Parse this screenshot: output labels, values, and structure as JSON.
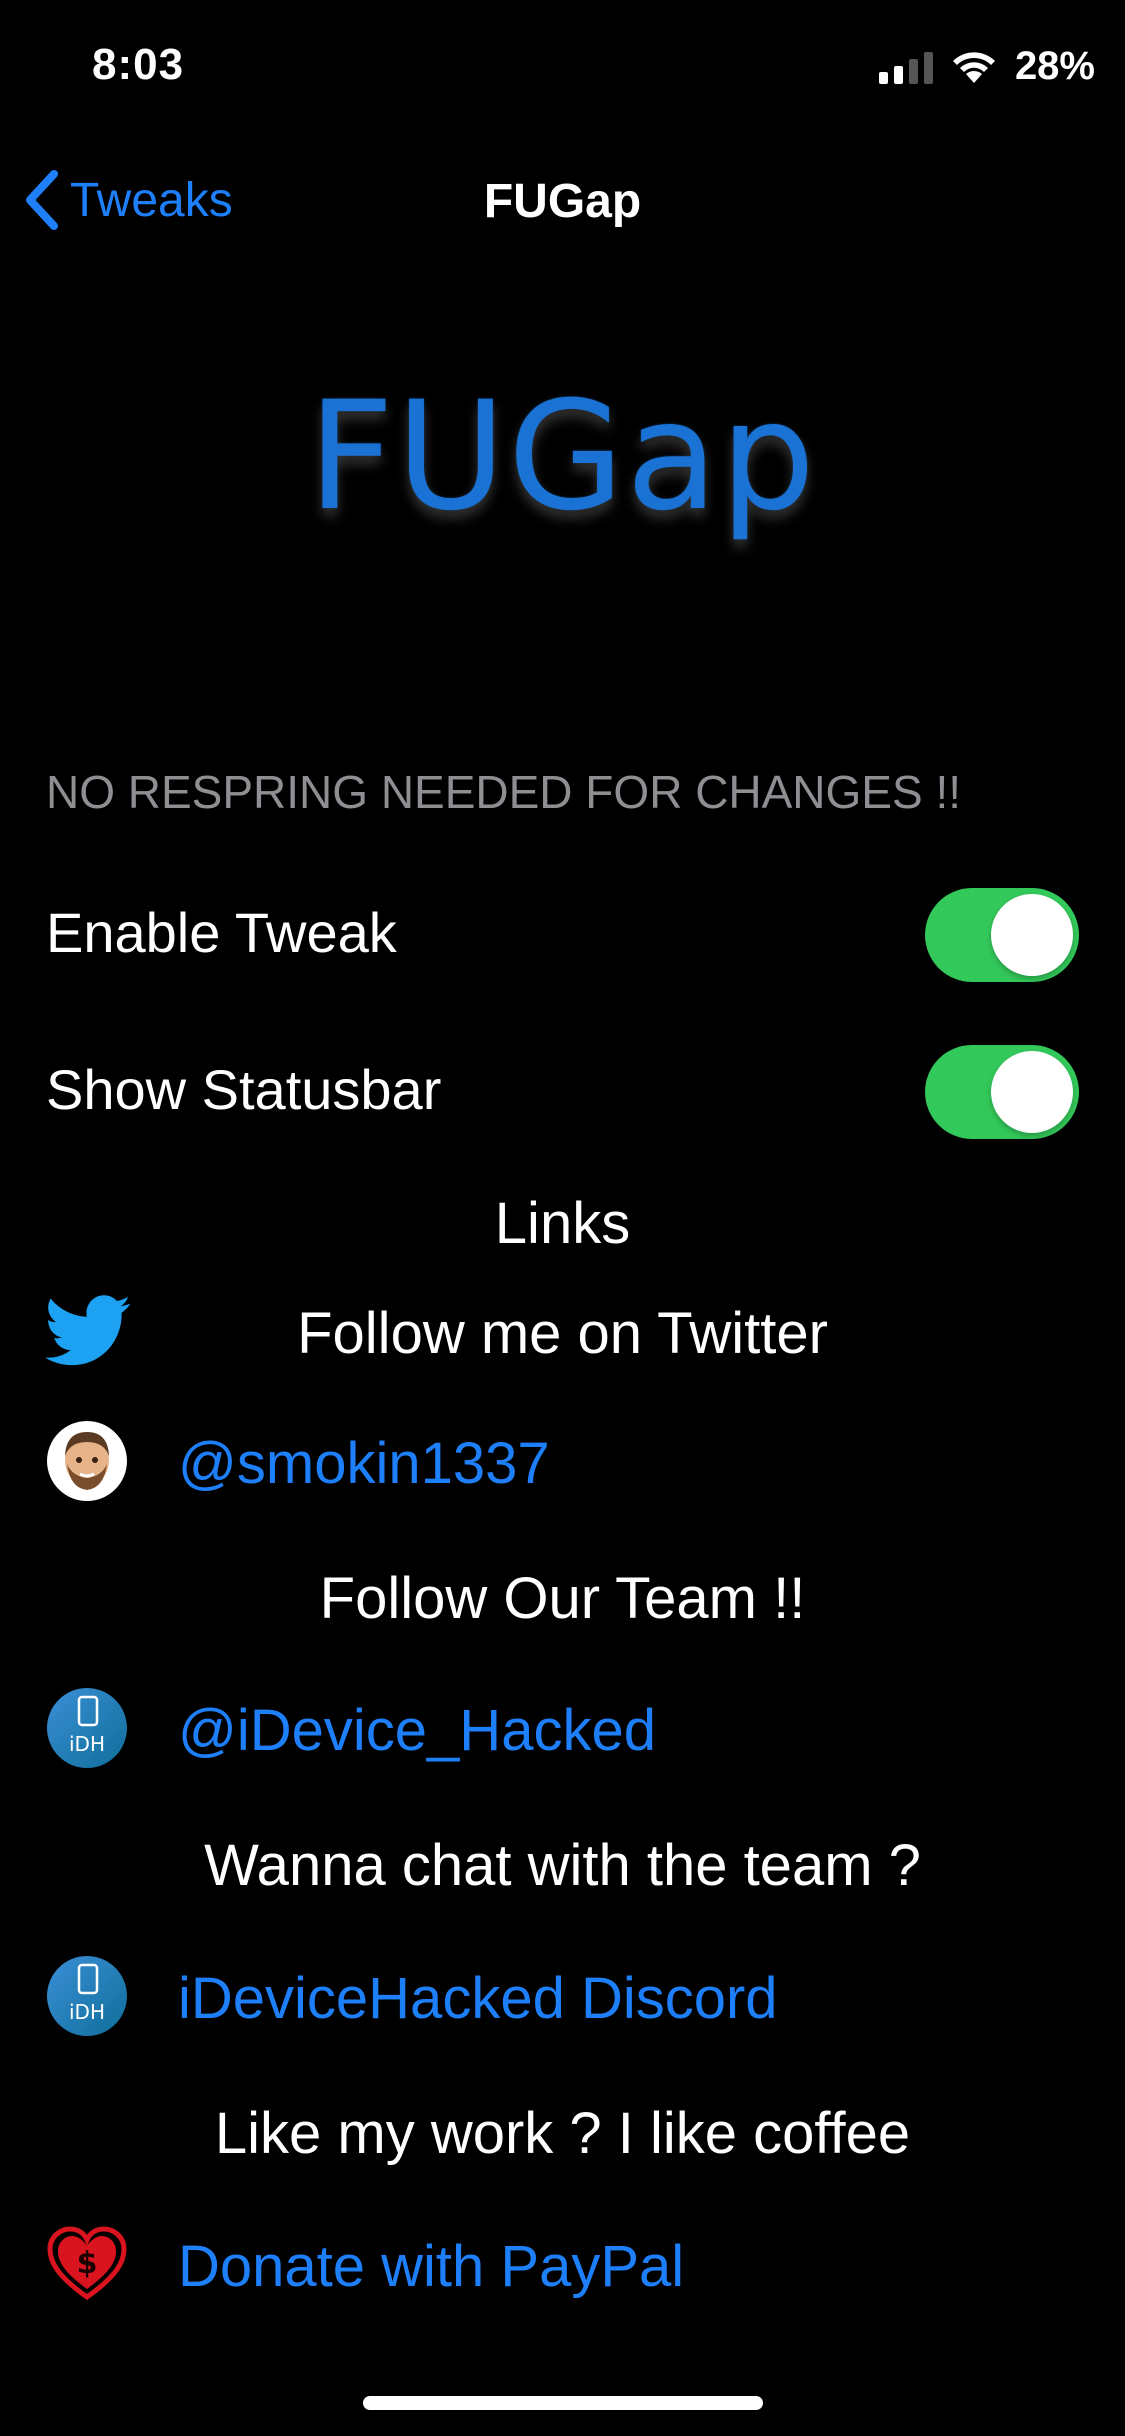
{
  "status_bar": {
    "time": "8:03",
    "battery": "28%"
  },
  "nav": {
    "back_label": "Tweaks",
    "title": "FUGap"
  },
  "header": {
    "logo_text": "FUGap",
    "logo_color": "#1a72d4"
  },
  "settings": {
    "section_header": "NO RESPRING NEEDED FOR CHANGES !!",
    "toggles": [
      {
        "label": "Enable Tweak",
        "on": true
      },
      {
        "label": "Show Statusbar",
        "on": true
      }
    ]
  },
  "links": {
    "heading": "Links",
    "twitter_label": "Follow me on Twitter",
    "smokin_label": "@smokin1337",
    "team_heading": "Follow Our Team !!",
    "idh_label": "@iDevice_Hacked",
    "chat_heading": "Wanna chat with the team ?",
    "discord_label": "iDeviceHacked Discord",
    "coffee_heading": "Like my work ? I like coffee",
    "paypal_label": "Donate with PayPal"
  },
  "colors": {
    "accent": "#1e7ffb",
    "toggle_on": "#33c95a",
    "background": "#000000"
  },
  "icons": {
    "twitter": "twitter-bird-icon",
    "avatar": "avatar-icon",
    "idh": "idevice-hacked-icon",
    "paypal": "heart-dollar-icon"
  }
}
